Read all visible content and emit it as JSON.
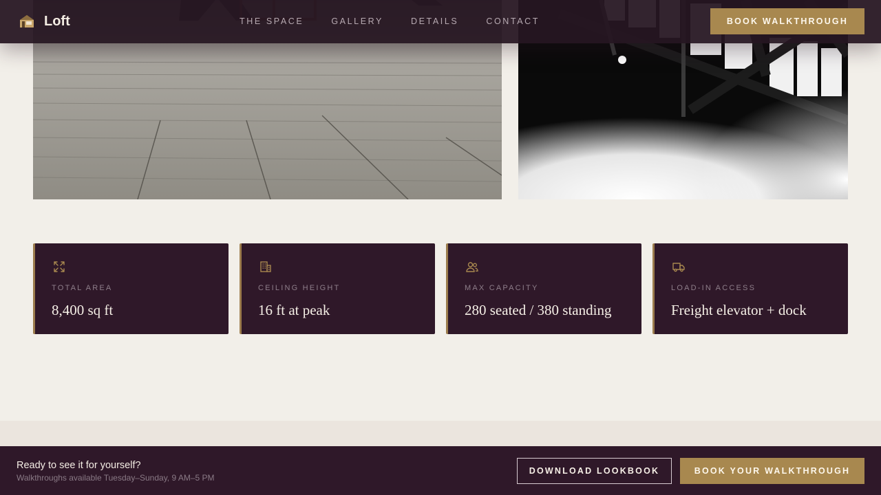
{
  "brand": {
    "name": "Loft",
    "logo_icon": "house-icon"
  },
  "nav": {
    "items": [
      {
        "label": "THE SPACE"
      },
      {
        "label": "GALLERY"
      },
      {
        "label": "DETAILS"
      },
      {
        "label": "CONTACT"
      }
    ]
  },
  "header": {
    "cta_label": "BOOK WALKTHROUGH"
  },
  "gallery": {
    "photos": [
      {
        "subject": "wooden-floor-photo"
      },
      {
        "subject": "roof-trusses-photo"
      }
    ]
  },
  "stats": [
    {
      "icon": "expand-arrows-icon",
      "label": "TOTAL AREA",
      "value": "8,400 sq ft"
    },
    {
      "icon": "building-icon",
      "label": "CEILING HEIGHT",
      "value": "16 ft at peak"
    },
    {
      "icon": "users-icon",
      "label": "MAX CAPACITY",
      "value": "280 seated / 380 standing"
    },
    {
      "icon": "truck-icon",
      "label": "LOAD-IN ACCESS",
      "value": "Freight elevator + dock"
    }
  ],
  "cta_bar": {
    "title": "Ready to see it for yourself?",
    "subtitle": "Walkthroughs available Tuesday–Sunday, 9 AM–5 PM",
    "secondary_label": "DOWNLOAD LOOKBOOK",
    "primary_label": "BOOK YOUR WALKTHROUGH"
  },
  "colors": {
    "accent": "#a8884f",
    "plum": "#2f1829",
    "background": "#f2efe9"
  }
}
